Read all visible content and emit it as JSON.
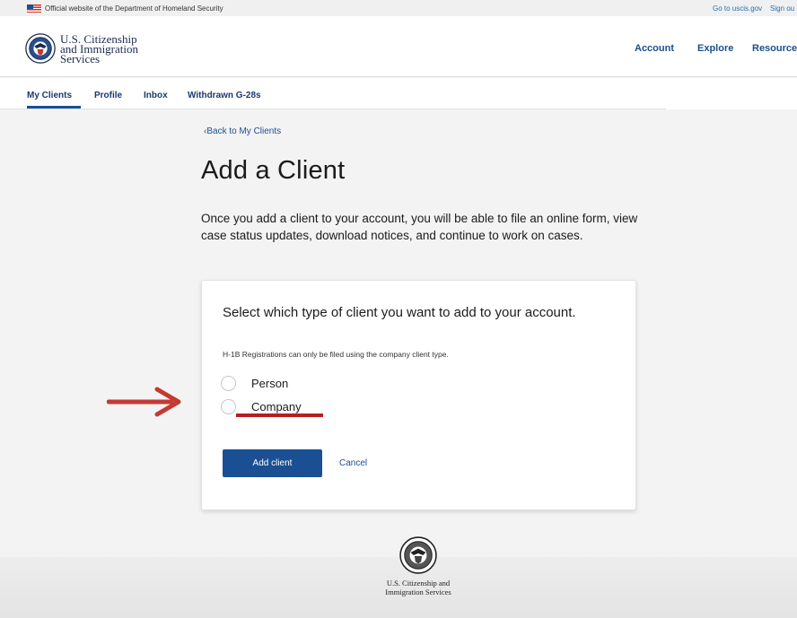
{
  "gov_banner": {
    "text": "Official website of the Department of Homeland Security",
    "link_uscis": "Go to uscis.gov",
    "link_signout": "Sign ou"
  },
  "header": {
    "agency_line1": "U.S. Citizenship",
    "agency_line2": "and Immigration",
    "agency_line3": "Services",
    "nav": [
      "Account",
      "Explore",
      "Resources"
    ]
  },
  "sub_nav": {
    "items": [
      "My Clients",
      "Profile",
      "Inbox",
      "Withdrawn G-28s"
    ],
    "active": "My Clients"
  },
  "main": {
    "back_link": "Back to My Clients",
    "title": "Add a Client",
    "intro": "Once you add a client to your account, you will be able to file an online form, view case status updates, download notices, and continue to work on cases."
  },
  "card": {
    "heading": "Select which type of client you want to add to your account.",
    "note": "H-1B Registrations can only be filed using the company client type.",
    "options": [
      "Person",
      "Company"
    ],
    "selected": null,
    "submit_label": "Add client",
    "cancel_label": "Cancel"
  },
  "footer": {
    "line1": "U.S. Citizenship and",
    "line2": "Immigration Services"
  },
  "colors": {
    "primary": "#1a4f93",
    "annotation": "#b51f24",
    "nav_text": "#1b4f8e"
  }
}
